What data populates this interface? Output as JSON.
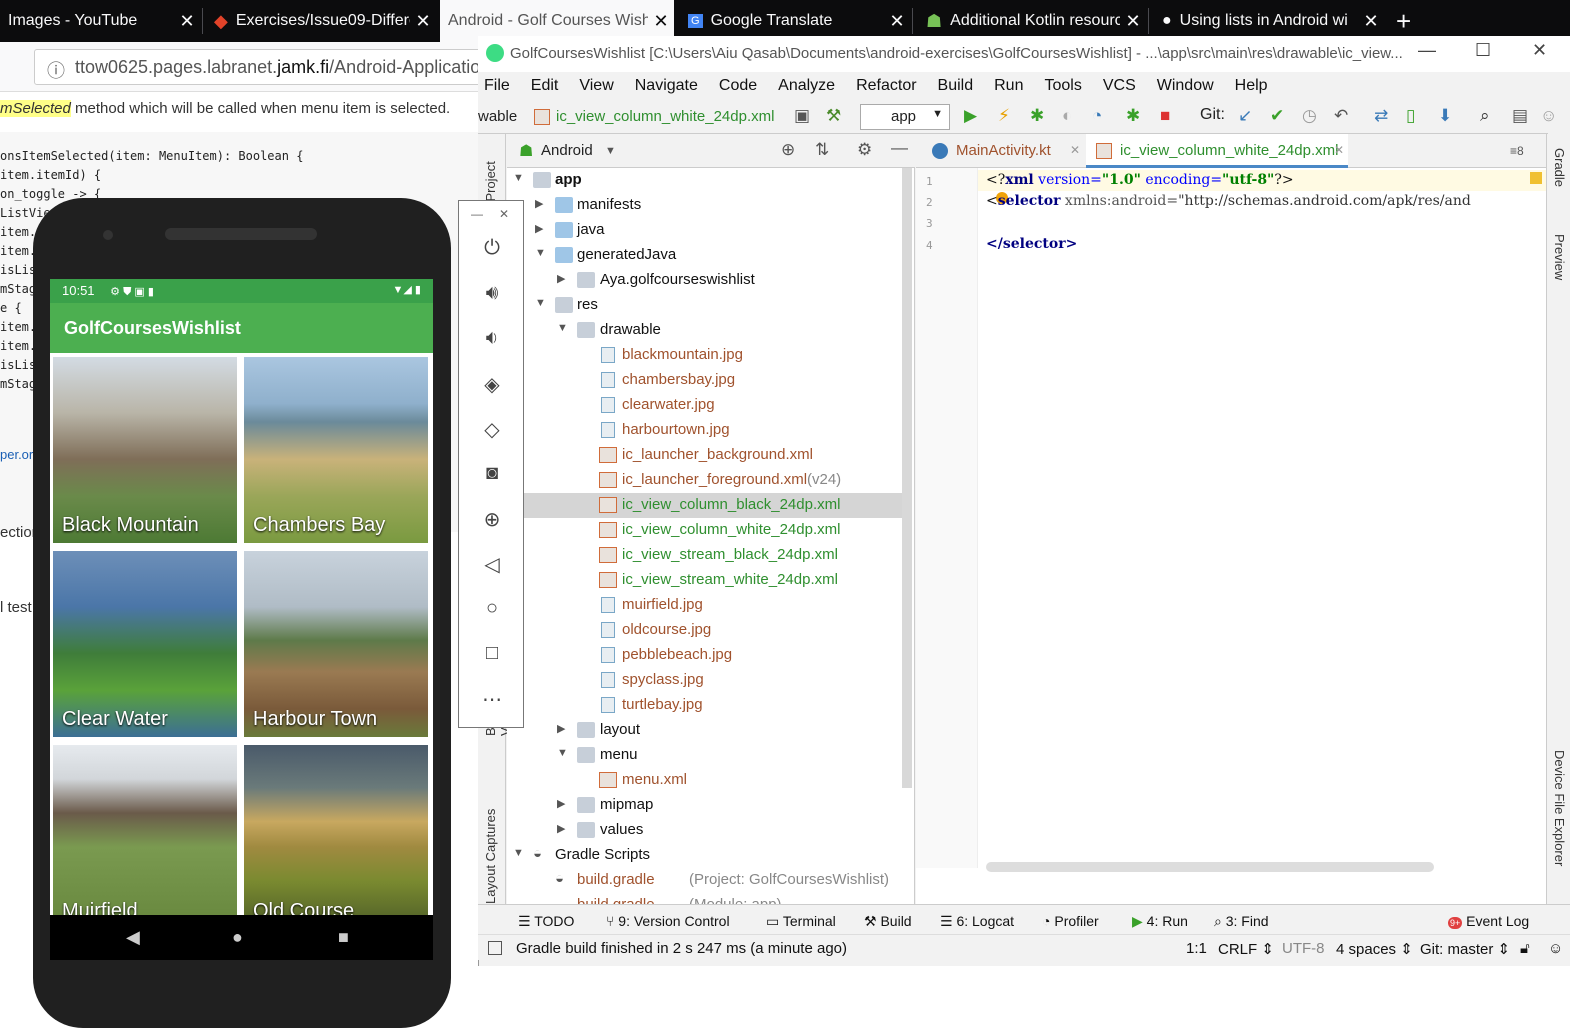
{
  "browser": {
    "tabs": [
      {
        "title": "Images - YouTube"
      },
      {
        "title": "Exercises/Issue09-Differe"
      },
      {
        "title": "Android - Golf Courses Wish"
      },
      {
        "title": "Google Translate"
      },
      {
        "title": "Additional Kotlin resourc"
      },
      {
        "title": "Using lists in Android wi"
      }
    ],
    "new_tab": "+",
    "url_prefix": "ttow0625.pages.labranet.",
    "url_domain": "jamk.fi",
    "url_suffix": "/Android-Application"
  },
  "webpage": {
    "line1_italic": "mSelected",
    "line1_rest": " method which will be called when menu item is selected.",
    "code_lines": [
      "onsItemSelected(item: MenuItem): Boolean {",
      "item.itemId) {",
      "on_toggle -> {",
      "ListVie",
      "item.s",
      "item.s",
      "isList",
      "mStag",
      "e {",
      "item.s",
      "item.s",
      "isList",
      "mStag"
    ],
    "link_fragment": "per.or",
    "frag2": "ection_",
    "frag3": "l test"
  },
  "ide": {
    "title": "GolfCoursesWishlist [C:\\Users\\Aiu Qasab\\Documents\\android-exercises\\GolfCoursesWishlist] - ...\\app\\src\\main\\res\\drawable\\ic_view...",
    "menu": [
      "File",
      "Edit",
      "View",
      "Navigate",
      "Code",
      "Analyze",
      "Refactor",
      "Build",
      "Run",
      "Tools",
      "VCS",
      "Window",
      "Help"
    ],
    "breadcrumb_prefix": "wable",
    "breadcrumb_file": "ic_view_column_white_24dp.xml",
    "run_config": "app",
    "git_label": "Git:",
    "project_view": "Android",
    "left_strip": [
      "1: Project",
      "Build Variants",
      "Layout Captures"
    ],
    "right_strip": [
      "Gradle",
      "Preview",
      "Device File Explorer"
    ],
    "tree": [
      {
        "label": "app",
        "bold": true
      },
      {
        "label": "manifests"
      },
      {
        "label": "java"
      },
      {
        "label": "generatedJava"
      },
      {
        "label": "Aya.golfcourseswishlist"
      },
      {
        "label": "res"
      },
      {
        "label": "drawable"
      },
      {
        "label": "blackmountain.jpg"
      },
      {
        "label": "chambersbay.jpg"
      },
      {
        "label": "clearwater.jpg"
      },
      {
        "label": "harbourtown.jpg"
      },
      {
        "label": "ic_launcher_background.xml"
      },
      {
        "label": "ic_launcher_foreground.xml",
        "suffix": "(v24)"
      },
      {
        "label": "ic_view_column_black_24dp.xml"
      },
      {
        "label": "ic_view_column_white_24dp.xml"
      },
      {
        "label": "ic_view_stream_black_24dp.xml"
      },
      {
        "label": "ic_view_stream_white_24dp.xml"
      },
      {
        "label": "muirfield.jpg"
      },
      {
        "label": "oldcourse.jpg"
      },
      {
        "label": "pebblebeach.jpg"
      },
      {
        "label": "spyclass.jpg"
      },
      {
        "label": "turtlebay.jpg"
      },
      {
        "label": "layout"
      },
      {
        "label": "menu"
      },
      {
        "label": "menu.xml"
      },
      {
        "label": "mipmap"
      },
      {
        "label": "values"
      },
      {
        "label": "Gradle Scripts"
      },
      {
        "label": "build.gradle",
        "suffix": "(Project: GolfCoursesWishlist)"
      },
      {
        "label": "build.gradle",
        "suffix": "(Module: app)"
      }
    ],
    "editor_tabs": [
      "MainActivity.kt",
      "ic_view_column_white_24dp.xml"
    ],
    "editor_overflow": "≡8",
    "code": {
      "line_numbers": [
        "1",
        "2",
        "3",
        "4"
      ],
      "l1_a": "<?",
      "l1_b": "xml",
      "l1_c": " version=",
      "l1_d": "\"1.0\"",
      "l1_e": " encoding=",
      "l1_f": "\"utf-8\"",
      "l1_g": "?>",
      "l2_a": "<",
      "l2_b": "selector",
      "l2_c": " xmlns:android=",
      "l2_d": "\"http://schemas.android.com/apk/res/and",
      "l4": "</selector>"
    },
    "bottom_tools": [
      {
        "label": "TODO"
      },
      {
        "label": "9: Version Control"
      },
      {
        "label": "Terminal"
      },
      {
        "label": "Build"
      },
      {
        "label": "6: Logcat"
      },
      {
        "label": "Profiler"
      },
      {
        "label": "4: Run"
      },
      {
        "label": "3: Find"
      },
      {
        "label": "Event Log"
      }
    ],
    "event_badge": "9+",
    "status": {
      "message": "Gradle build finished in 2 s 247 ms (a minute ago)",
      "position": "1:1",
      "line_sep": "CRLF ⇕",
      "encoding": "UTF-8",
      "indent": "4 spaces ⇕",
      "git": "Git: master ⇕"
    }
  },
  "emulator_controls": [
    "minimize",
    "close",
    "power-icon",
    "volume-up-icon",
    "volume-down-icon",
    "rotate-left-icon",
    "rotate-right-icon",
    "camera-icon",
    "zoom-icon",
    "back-icon",
    "home-icon",
    "overview-icon",
    "more-icon"
  ],
  "phone": {
    "time": "10:51",
    "app_title": "GolfCoursesWishlist",
    "cards": [
      {
        "name": "Black Mountain"
      },
      {
        "name": "Chambers Bay"
      },
      {
        "name": "Clear Water"
      },
      {
        "name": "Harbour Town"
      },
      {
        "name": "Muirfield"
      },
      {
        "name": "Old Course"
      }
    ]
  },
  "colors": {
    "appbar": "#4caf50",
    "statusbar": "#3aa14a",
    "ide_bg": "#f2f2f2",
    "firefox_tabs": "#0c0c0d"
  }
}
